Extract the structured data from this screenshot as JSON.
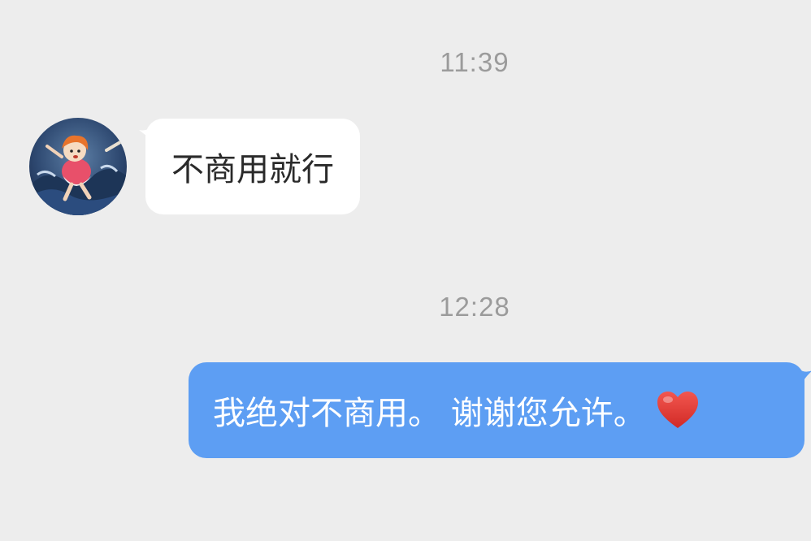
{
  "conversation": {
    "messages": [
      {
        "timestamp": "11:39",
        "sender": "other",
        "text": "不商用就行"
      },
      {
        "timestamp": "12:28",
        "sender": "self",
        "text": "我绝对不商用。 谢谢您允许。",
        "emoji": "heart"
      }
    ]
  },
  "colors": {
    "background": "#ededed",
    "incoming_bubble": "#ffffff",
    "outgoing_bubble": "#5d9ef3",
    "timestamp": "#9b9b9b",
    "heart": "#e0322f"
  },
  "icons": {
    "avatar": "avatar-image",
    "emoji": "red-heart-icon"
  }
}
